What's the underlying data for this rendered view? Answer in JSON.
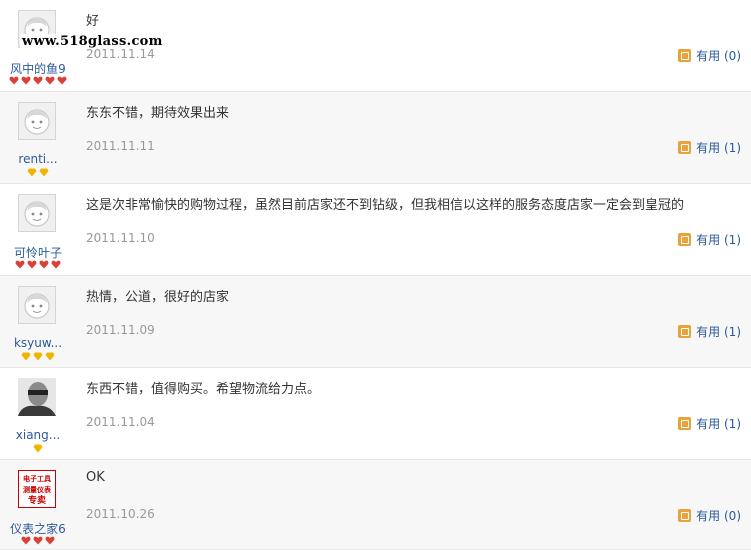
{
  "watermark": "www.518glass.com",
  "useful_label": "有用",
  "reviews": [
    {
      "user": "风中的鱼9",
      "content": "好",
      "date": "2011.11.14",
      "useful": "(0)",
      "badge_type": "heart-badge",
      "badge_count": 5,
      "avatar": "default-avatar"
    },
    {
      "user": "renti...",
      "content": "东东不错，期待效果出来",
      "date": "2011.11.11",
      "useful": "(1)",
      "badge_type": "diamond-badge",
      "badge_count": 2,
      "avatar": "default-avatar"
    },
    {
      "user": "可怜叶子",
      "content": "这是次非常愉快的购物过程，虽然目前店家还不到钻级，但我相信以这样的服务态度店家一定会到皇冠的",
      "date": "2011.11.10",
      "useful": "(1)",
      "badge_type": "heart-badge",
      "badge_count": 4,
      "avatar": "default-avatar"
    },
    {
      "user": "ksyuw...",
      "content": "热情，公道，很好的店家",
      "date": "2011.11.09",
      "useful": "(1)",
      "badge_type": "diamond-badge",
      "badge_count": 3,
      "avatar": "default-avatar"
    },
    {
      "user": "xiang...",
      "content": "东西不错，值得购买。希望物流给力点。",
      "date": "2011.11.04",
      "useful": "(1)",
      "badge_type": "diamond-badge",
      "badge_count": 1,
      "avatar": "photo-avatar"
    },
    {
      "user": "仪表之家6",
      "content": "OK",
      "date": "2011.10.26",
      "useful": "(0)",
      "badge_type": "heart-badge",
      "badge_count": 3,
      "avatar": "shop-logo-avatar",
      "avatar_lines": [
        "电子工具",
        "测量仪表",
        "专卖"
      ]
    }
  ],
  "colors": {
    "heart": "#d9413a",
    "diamond": "#f0b400",
    "link": "#2b5a9b",
    "date": "#999999",
    "alt_row": "#f7f7f7"
  }
}
